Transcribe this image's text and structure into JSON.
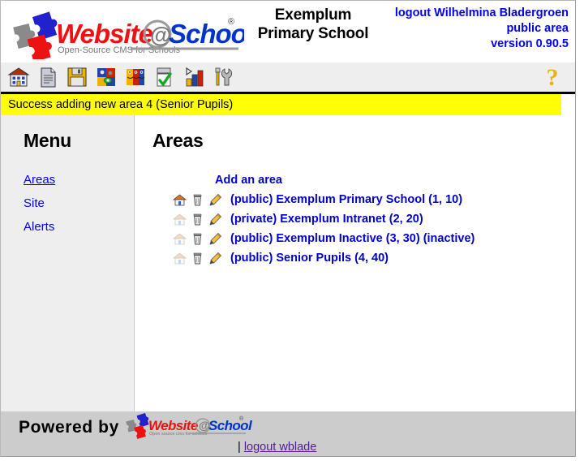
{
  "header": {
    "logo_alt": "Website@School",
    "logo_text_part1": "Website",
    "logo_text_at": "@",
    "logo_text_part2": "School",
    "logo_registered": "®",
    "logo_tagline": "Open-Source CMS for Schools",
    "school_name_line1": "Exemplum",
    "school_name_line2": "Primary School",
    "logout_label": "logout Wilhelmina Bladergroen",
    "area_label": "public area",
    "version_label": "version 0.90.5"
  },
  "toolbar": {
    "icons": [
      {
        "name": "school-home-icon",
        "title": "Home"
      },
      {
        "name": "page-document-icon",
        "title": "Pages"
      },
      {
        "name": "floppy-save-icon",
        "title": "File manager"
      },
      {
        "name": "modules-puzzle-icon",
        "title": "Modules"
      },
      {
        "name": "users-faces-icon",
        "title": "Users"
      },
      {
        "name": "checklist-icon",
        "title": "Tasks"
      },
      {
        "name": "statistics-bar-chart-icon",
        "title": "Statistics"
      },
      {
        "name": "tools-wrench-icon",
        "title": "Tools"
      }
    ],
    "help_label": "?"
  },
  "message": {
    "text": "Success adding new area 4 (Senior Pupils)",
    "background": "#ffff00"
  },
  "sidebar": {
    "title": "Menu",
    "items": [
      {
        "label": "Areas",
        "active": true
      },
      {
        "label": "Site",
        "active": false
      },
      {
        "label": "Alerts",
        "active": false
      }
    ]
  },
  "main": {
    "title": "Areas",
    "add_area_label": "Add an area",
    "rows": [
      {
        "label": "(public) Exemplum Primary School (1, 10)",
        "home_enabled": true,
        "delete_enabled": true,
        "edit_enabled": true
      },
      {
        "label": "(private) Exemplum Intranet (2, 20)",
        "home_enabled": false,
        "delete_enabled": true,
        "edit_enabled": true
      },
      {
        "label": "(public) Exemplum Inactive (3, 30) (inactive)",
        "home_enabled": false,
        "delete_enabled": true,
        "edit_enabled": true
      },
      {
        "label": "(public) Senior Pupils (4, 40)",
        "home_enabled": false,
        "delete_enabled": true,
        "edit_enabled": true
      }
    ],
    "row_icon_names": {
      "home": "set-default-home-icon",
      "delete": "delete-trash-icon",
      "edit": "edit-pencil-icon"
    }
  },
  "footer": {
    "powered_by_label": "Powered by",
    "logo_text_part1": "Website",
    "logo_text_at": "@",
    "logo_text_part2": "School",
    "logo_registered": "®",
    "logo_tagline": "Open source cms for schools",
    "separator": "|",
    "logout_label": "logout wblade"
  },
  "colors": {
    "link": "#0000ee",
    "link_bold": "#0000cc",
    "visited_link": "#551a8b",
    "message_bg": "#ffff00",
    "sidebar_bg": "#eeeeee",
    "toolbar_bg": "#eeeeee",
    "footer_bg": "#cccccc",
    "logo_red": "#ee1111",
    "logo_blue": "#0033cc",
    "help_gold": "#eeb111"
  }
}
